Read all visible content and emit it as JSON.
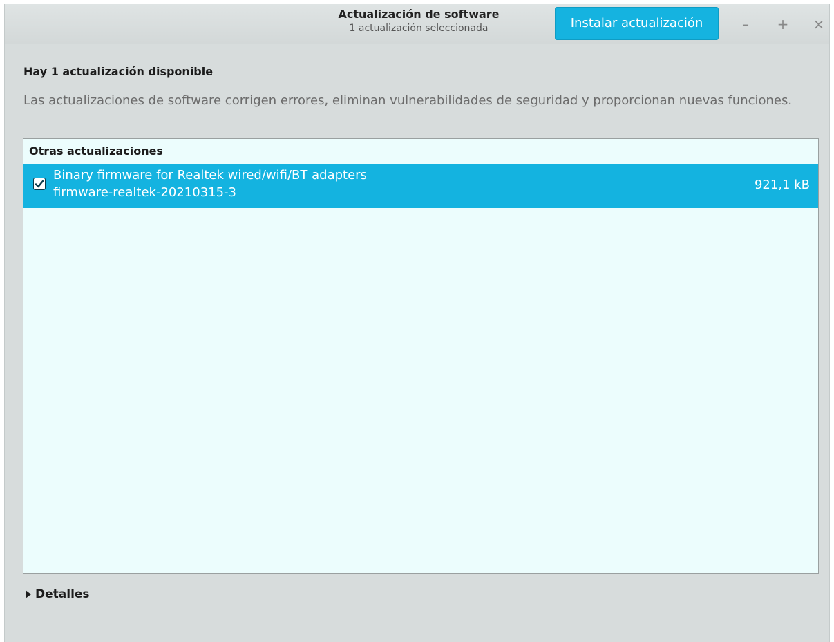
{
  "header": {
    "title": "Actualización de software",
    "subtitle": "1 actualización seleccionada",
    "install_button": "Instalar actualización",
    "controls": {
      "minimize": "–",
      "maximize": "+",
      "close": "×"
    }
  },
  "main": {
    "headline": "Hay 1 actualización disponible",
    "description": "Las actualizaciones de software corrigen errores, eliminan vulnerabilidades de seguridad y proporcionan nuevas funciones.",
    "section_title": "Otras actualizaciones",
    "updates": [
      {
        "name": "Binary firmware for Realtek wired/wifi/BT adapters",
        "package": "firmware-realtek-20210315-3",
        "size": "921,1 kB",
        "checked": true
      }
    ],
    "details_label": "Detalles"
  },
  "colors": {
    "accent": "#14b3e0",
    "window_bg": "#d7dcdc",
    "list_bg": "#ecfdfd"
  },
  "icons": {
    "checkbox": "checkbox-checked-icon",
    "expander": "triangle-right-icon"
  }
}
